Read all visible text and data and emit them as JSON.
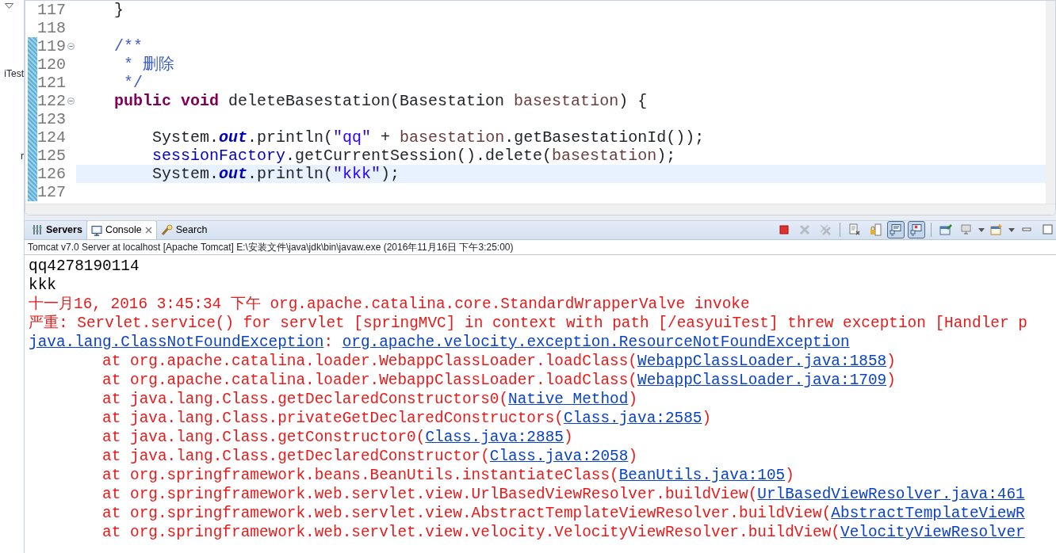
{
  "sidebar": {
    "fragments": [
      "iTest",
      "r"
    ]
  },
  "editor": {
    "lines": [
      {
        "number": "117",
        "changed": false,
        "foldable": false,
        "current": false,
        "tokens": [
          {
            "kind": "plain",
            "text": "    }"
          }
        ]
      },
      {
        "number": "118",
        "changed": false,
        "foldable": false,
        "current": false
      },
      {
        "number": "119",
        "changed": true,
        "foldable": true,
        "current": false,
        "tokens": [
          {
            "kind": "comment",
            "text": "    /**"
          }
        ]
      },
      {
        "number": "120",
        "changed": true,
        "foldable": false,
        "current": false,
        "tokens": [
          {
            "kind": "comment",
            "text": "     * 删除"
          }
        ]
      },
      {
        "number": "121",
        "changed": true,
        "foldable": false,
        "current": false,
        "tokens": [
          {
            "kind": "comment",
            "text": "     */"
          }
        ]
      },
      {
        "number": "122",
        "changed": true,
        "foldable": true,
        "current": false,
        "tokens": [
          {
            "kind": "keyword",
            "text": "    public"
          },
          {
            "kind": "keyword",
            "text": " void"
          },
          {
            "kind": "plain",
            "text": " deleteBasestation(Basestation "
          },
          {
            "kind": "param",
            "text": "basestation"
          },
          {
            "kind": "plain",
            "text": ") {"
          }
        ]
      },
      {
        "number": "123",
        "changed": true,
        "foldable": false,
        "current": false
      },
      {
        "number": "124",
        "changed": true,
        "foldable": false,
        "current": false,
        "tokens": [
          {
            "kind": "plain",
            "text": "        System."
          },
          {
            "kind": "static",
            "text": "out"
          },
          {
            "kind": "plain",
            "text": ".println("
          },
          {
            "kind": "string",
            "text": "\"qq\""
          },
          {
            "kind": "plain",
            "text": " + "
          },
          {
            "kind": "param",
            "text": "basestation"
          },
          {
            "kind": "plain",
            "text": ".getBasestationId());"
          }
        ]
      },
      {
        "number": "125",
        "changed": true,
        "foldable": false,
        "current": false,
        "tokens": [
          {
            "kind": "field",
            "text": "        sessionFactory"
          },
          {
            "kind": "plain",
            "text": ".getCurrentSession().delete("
          },
          {
            "kind": "param",
            "text": "basestation"
          },
          {
            "kind": "plain",
            "text": ");"
          }
        ]
      },
      {
        "number": "126",
        "changed": true,
        "foldable": false,
        "current": true,
        "tokens": [
          {
            "kind": "plain",
            "text": "        System."
          },
          {
            "kind": "static",
            "text": "out"
          },
          {
            "kind": "plain",
            "text": ".println("
          },
          {
            "kind": "string",
            "text": "\"kkk\""
          },
          {
            "kind": "plain",
            "text": ");"
          }
        ]
      },
      {
        "number": "127",
        "changed": true,
        "foldable": false,
        "current": false
      }
    ]
  },
  "console": {
    "tabs": [
      {
        "label": "Servers",
        "kind": "servers",
        "selected": false,
        "bold": true,
        "closable": false
      },
      {
        "label": "Console",
        "kind": "console",
        "selected": true,
        "bold": false,
        "closable": true
      },
      {
        "label": "Search",
        "kind": "search",
        "selected": false,
        "bold": false,
        "closable": false
      }
    ],
    "toolbar": [
      {
        "kind": "stop",
        "disabled": false,
        "pressed": false
      },
      {
        "kind": "remove",
        "disabled": true,
        "pressed": false
      },
      {
        "kind": "remove-all",
        "disabled": true,
        "pressed": false
      },
      {
        "kind": "sep"
      },
      {
        "kind": "clear",
        "disabled": false,
        "pressed": false
      },
      {
        "kind": "scroll-lock",
        "disabled": false,
        "pressed": false
      },
      {
        "kind": "stdout",
        "disabled": false,
        "pressed": true
      },
      {
        "kind": "stderr",
        "disabled": false,
        "pressed": true
      },
      {
        "kind": "sep"
      },
      {
        "kind": "pin",
        "disabled": false,
        "pressed": false
      },
      {
        "kind": "display",
        "disabled": false,
        "pressed": false
      },
      {
        "kind": "open",
        "disabled": false,
        "pressed": false
      },
      {
        "kind": "minimize",
        "disabled": false,
        "pressed": false
      },
      {
        "kind": "maximize",
        "disabled": false,
        "pressed": false
      }
    ],
    "process": "Tomcat v7.0 Server at localhost [Apache Tomcat] E:\\安装文件\\java\\jdk\\bin\\javaw.exe (2016年11月16日 下午3:25:00)",
    "lines": [
      {
        "tokens": [
          {
            "kind": "out",
            "text": "qq4278190114"
          }
        ]
      },
      {
        "tokens": [
          {
            "kind": "out",
            "text": "kkk"
          }
        ]
      },
      {
        "tokens": [
          {
            "kind": "err",
            "text": "十一月16, 2016 3:45:34 下午 org.apache.catalina.core.StandardWrapperValve invoke"
          }
        ]
      },
      {
        "tokens": [
          {
            "kind": "err",
            "text": "严重: Servlet.service() for servlet [springMVC] in context with path [/easyuiTest] threw exception [Handler p"
          }
        ]
      },
      {
        "tokens": [
          {
            "kind": "link",
            "text": "java.lang.ClassNotFoundException"
          },
          {
            "kind": "err",
            "text": ": "
          },
          {
            "kind": "link",
            "text": "org.apache.velocity.exception.ResourceNotFoundException"
          }
        ]
      },
      {
        "tokens": [
          {
            "kind": "err",
            "text": "        at org.apache.catalina.loader.WebappClassLoader.loadClass("
          },
          {
            "kind": "link",
            "text": "WebappClassLoader.java:1858"
          },
          {
            "kind": "err",
            "text": ")"
          }
        ]
      },
      {
        "tokens": [
          {
            "kind": "err",
            "text": "        at org.apache.catalina.loader.WebappClassLoader.loadClass("
          },
          {
            "kind": "link",
            "text": "WebappClassLoader.java:1709"
          },
          {
            "kind": "err",
            "text": ")"
          }
        ]
      },
      {
        "tokens": [
          {
            "kind": "err",
            "text": "        at java.lang.Class.getDeclaredConstructors0("
          },
          {
            "kind": "link",
            "text": "Native Method"
          },
          {
            "kind": "err",
            "text": ")"
          }
        ]
      },
      {
        "tokens": [
          {
            "kind": "err",
            "text": "        at java.lang.Class.privateGetDeclaredConstructors("
          },
          {
            "kind": "link",
            "text": "Class.java:2585"
          },
          {
            "kind": "err",
            "text": ")"
          }
        ]
      },
      {
        "tokens": [
          {
            "kind": "err",
            "text": "        at java.lang.Class.getConstructor0("
          },
          {
            "kind": "link",
            "text": "Class.java:2885"
          },
          {
            "kind": "err",
            "text": ")"
          }
        ]
      },
      {
        "tokens": [
          {
            "kind": "err",
            "text": "        at java.lang.Class.getDeclaredConstructor("
          },
          {
            "kind": "link",
            "text": "Class.java:2058"
          },
          {
            "kind": "err",
            "text": ")"
          }
        ]
      },
      {
        "tokens": [
          {
            "kind": "err",
            "text": "        at org.springframework.beans.BeanUtils.instantiateClass("
          },
          {
            "kind": "link",
            "text": "BeanUtils.java:105"
          },
          {
            "kind": "err",
            "text": ")"
          }
        ]
      },
      {
        "tokens": [
          {
            "kind": "err",
            "text": "        at org.springframework.web.servlet.view.UrlBasedViewResolver.buildView("
          },
          {
            "kind": "link",
            "text": "UrlBasedViewResolver.java:461"
          }
        ]
      },
      {
        "tokens": [
          {
            "kind": "err",
            "text": "        at org.springframework.web.servlet.view.AbstractTemplateViewResolver.buildView("
          },
          {
            "kind": "link",
            "text": "AbstractTemplateViewR"
          }
        ]
      },
      {
        "tokens": [
          {
            "kind": "err",
            "text": "        at org.springframework.web.servlet.view.velocity.VelocityViewResolver.buildView("
          },
          {
            "kind": "link",
            "text": "VelocityViewResolver"
          }
        ]
      }
    ]
  }
}
